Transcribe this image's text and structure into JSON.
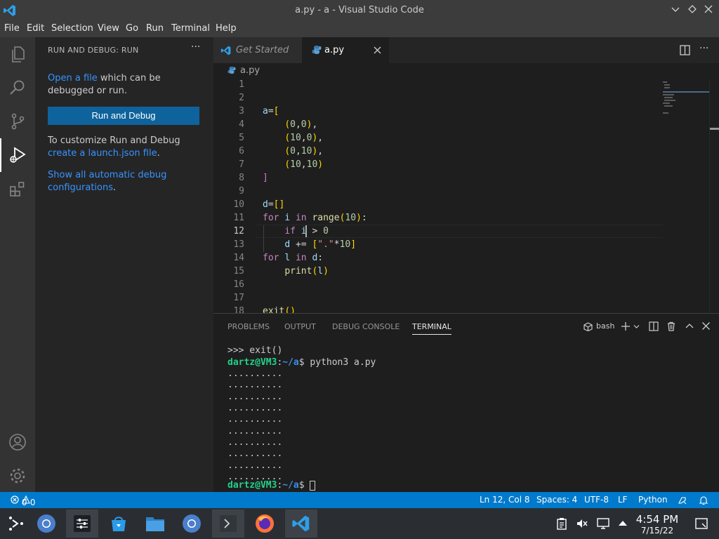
{
  "window": {
    "title": "a.py - a - Visual Studio Code"
  },
  "menu": {
    "items": [
      "File",
      "Edit",
      "Selection",
      "View",
      "Go",
      "Run",
      "Terminal",
      "Help"
    ]
  },
  "sidebar": {
    "header": "RUN AND DEBUG: RUN",
    "open_file_link": "Open a file",
    "open_file_text": " which can be debugged or run.",
    "run_button": "Run and Debug",
    "customize_text": "To customize Run and Debug",
    "launch_link": "create a launch.json file",
    "launch_suffix": ".",
    "show_all_link": "Show all automatic debug configurations",
    "show_all_suffix": "."
  },
  "tabs": [
    {
      "label": "Get Started",
      "icon": "vscode-logo-icon",
      "active": false
    },
    {
      "label": "a.py",
      "icon": "python-file-icon",
      "active": true
    }
  ],
  "breadcrumb": {
    "file": "a.py"
  },
  "editor": {
    "language": "python",
    "current_line": 12,
    "line_numbers": [
      "1",
      "2",
      "3",
      "4",
      "5",
      "6",
      "7",
      "8",
      "9",
      "10",
      "11",
      "12",
      "13",
      "14",
      "15",
      "16",
      "17",
      "18"
    ],
    "lines": [
      "",
      "",
      "a=[",
      "    (0,0),",
      "    (10,0),",
      "    (0,10),",
      "    (10,10)",
      "]",
      "",
      "d=[]",
      "for i in range(10):",
      "    if i > 0",
      "    d += [\".\"*10]",
      "for l in d:",
      "    print(l)",
      "",
      "",
      "exit()"
    ]
  },
  "panel": {
    "tabs": [
      "PROBLEMS",
      "OUTPUT",
      "DEBUG CONSOLE",
      "TERMINAL"
    ],
    "active_tab": "TERMINAL",
    "shell": "bash",
    "terminal": {
      "first_line": ">>> exit()",
      "prompt_user": "dartz@VM3",
      "prompt_sep": ":",
      "prompt_path": "~/a",
      "prompt_end": "$ ",
      "command": "python3 a.py",
      "output_lines": [
        "..........",
        "..........",
        "..........",
        "..........",
        "..........",
        "..........",
        "..........",
        "..........",
        "..........",
        ".........."
      ]
    }
  },
  "status": {
    "errors": "0",
    "warnings": "0",
    "position": "Ln 12, Col 8",
    "spaces": "Spaces: 4",
    "encoding": "UTF-8",
    "eol": "LF",
    "language": "Python"
  },
  "taskbar": {
    "time": "4:54 PM",
    "date": "7/15/22"
  },
  "colors": {
    "accent": "#007acc",
    "run_button": "#0e639c",
    "link": "#3794ff",
    "terminal_user": "#23d18b",
    "terminal_path": "#3b8eea"
  }
}
